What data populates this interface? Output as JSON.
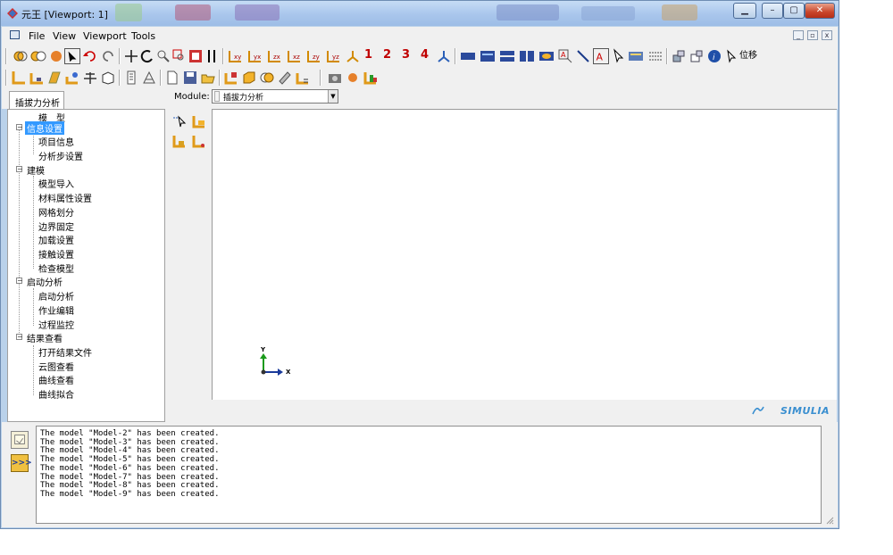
{
  "window": {
    "title": "元王 [Viewport: 1]"
  },
  "menubar": {
    "file": "File",
    "view": "View",
    "viewport": "Viewport",
    "tools": "Tools"
  },
  "toolbar": {
    "numbers": [
      "1",
      "2",
      "3",
      "4"
    ],
    "move_label": "位移"
  },
  "tab": {
    "label": "插拔力分析"
  },
  "module": {
    "label": "Module:",
    "value": "插拔力分析"
  },
  "tree": {
    "root_label": "模　型",
    "groups": [
      {
        "label": "信息设置",
        "items": [
          "项目信息",
          "分析步设置"
        ]
      },
      {
        "label": "建模",
        "items": [
          "模型导入",
          "材料属性设置",
          "网格划分",
          "边界固定",
          "加载设置",
          "接触设置",
          "检查模型"
        ]
      },
      {
        "label": "启动分析",
        "items": [
          "启动分析",
          "作业编辑",
          "过程监控"
        ]
      },
      {
        "label": "结果查看",
        "items": [
          "打开结果文件",
          "云图查看",
          "曲线查看",
          "曲线拟合"
        ]
      }
    ]
  },
  "triad": {
    "y": "Y",
    "x": "X"
  },
  "brand": "SIMULIA",
  "messages": [
    "The model \"Model-2\" has been created.",
    "The model \"Model-3\" has been created.",
    "The model \"Model-4\" has been created.",
    "The model \"Model-5\" has been created.",
    "The model \"Model-6\" has been created.",
    "The model \"Model-7\" has been created.",
    "The model \"Model-8\" has been created.",
    "The model \"Model-9\" has been created."
  ],
  "colors": {
    "title_bar": "#a9c6ec",
    "selected": "#3399ff",
    "numbers": "#c00000",
    "brand": "#3a8fd0"
  }
}
